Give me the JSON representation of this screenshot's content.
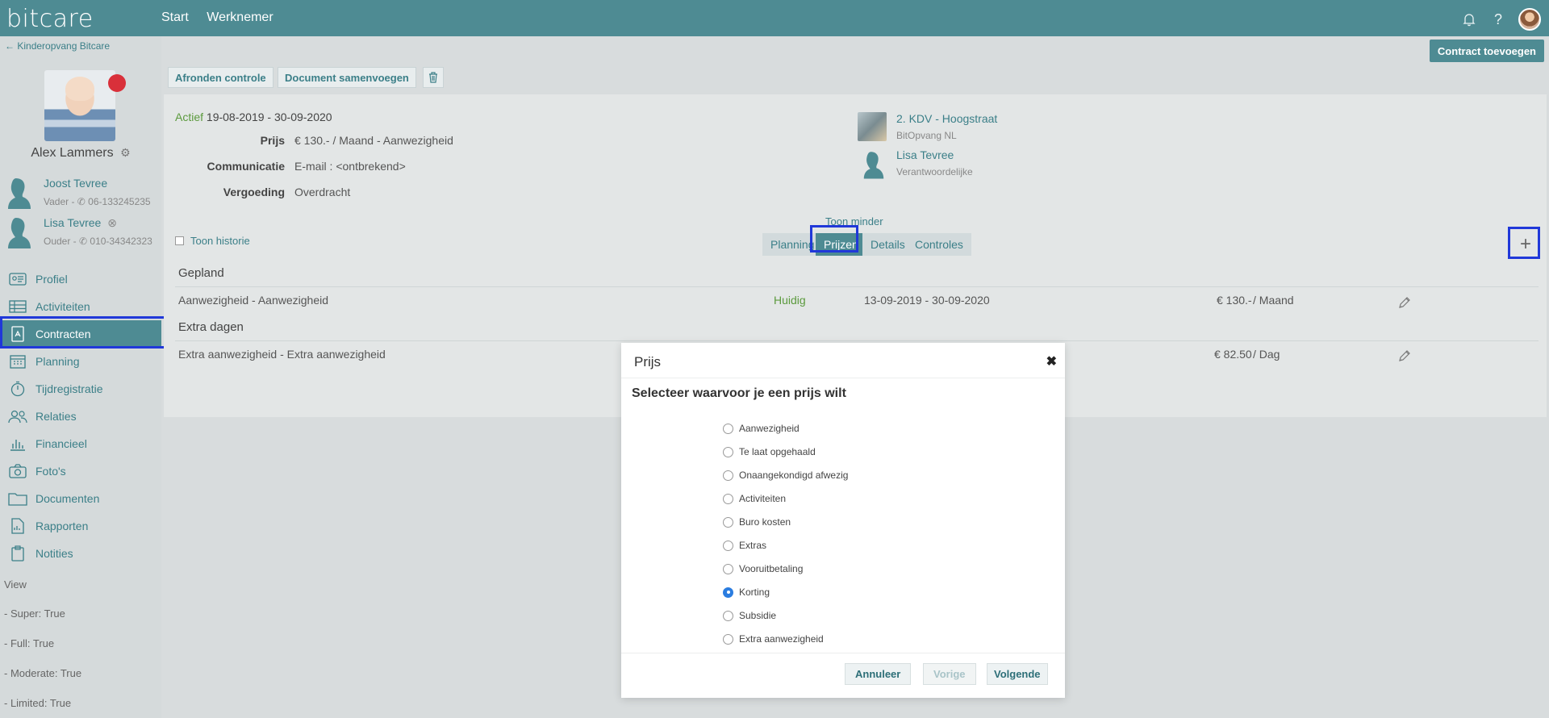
{
  "topbar": {
    "logo": "bitcare",
    "nav": [
      "Start",
      "Werknemer"
    ],
    "icons": [
      "bell-icon",
      "help-icon",
      "user-avatar"
    ]
  },
  "sidebar": {
    "back_label": "Kinderopvang Bitcare",
    "child_name": "Alex Lammers",
    "parents": [
      {
        "name": "Joost Tevree",
        "info": "Vader - ✆ 06-133245235"
      },
      {
        "name": "Lisa Tevree",
        "info": "Ouder - ✆ 010-34342323"
      }
    ],
    "nav": [
      {
        "label": "Profiel",
        "icon": "id-card-icon"
      },
      {
        "label": "Activiteiten",
        "icon": "table-icon"
      },
      {
        "label": "Contracten",
        "icon": "contract-icon",
        "active": true
      },
      {
        "label": "Planning",
        "icon": "calendar-icon"
      },
      {
        "label": "Tijdregistratie",
        "icon": "stopwatch-icon"
      },
      {
        "label": "Relaties",
        "icon": "people-icon"
      },
      {
        "label": "Financieel",
        "icon": "bar-chart-icon"
      },
      {
        "label": "Foto's",
        "icon": "camera-icon"
      },
      {
        "label": "Documenten",
        "icon": "folder-icon"
      },
      {
        "label": "Rapporten",
        "icon": "report-icon"
      },
      {
        "label": "Notities",
        "icon": "clipboard-icon"
      }
    ],
    "permissions": [
      "View",
      "- Super: True",
      "- Full: True",
      "- Moderate: True",
      "- Limited: True"
    ]
  },
  "main": {
    "contract_button": "Contract toevoegen",
    "actions": {
      "finish": "Afronden controle",
      "merge": "Document samenvoegen"
    },
    "contract": {
      "status": "Actief",
      "period": "19-08-2019 - 30-09-2020",
      "fields": [
        {
          "key": "Prijs",
          "value": "€ 130.- / Maand - Aanwezigheid"
        },
        {
          "key": "Communicatie",
          "value": "E-mail : <ontbrekend>"
        },
        {
          "key": "Vergoeding",
          "value": "Overdracht"
        }
      ],
      "location": {
        "name": "2. KDV - Hoogstraat",
        "sub": "BitOpvang NL"
      },
      "responsible": {
        "name": "Lisa Tevree",
        "sub": "Verantwoordelijke"
      }
    },
    "toon_minder": "Toon minder",
    "toon_historie": "Toon historie",
    "tabs": [
      "Planning",
      "Prijzen",
      "Details",
      "Controles"
    ],
    "sections": [
      {
        "title": "Gepland",
        "row": {
          "name": "Aanwezigheid - Aanwezigheid",
          "status": "Huidig",
          "period": "13-09-2019 - 30-09-2020",
          "price": "€ 130.-",
          "unit": "/ Maand"
        }
      },
      {
        "title": "Extra dagen",
        "row": {
          "name": "Extra aanwezigheid - Extra aanwezigheid",
          "status": "",
          "period": "",
          "price": "€ 82.50",
          "unit": "/ Dag"
        }
      }
    ]
  },
  "modal": {
    "title": "Prijs",
    "question": "Selecteer waarvoor je een prijs wilt",
    "options": [
      "Aanwezigheid",
      "Te laat opgehaald",
      "Onaangekondigd afwezig",
      "Activiteiten",
      "Buro kosten",
      "Extras",
      "Vooruitbetaling",
      "Korting",
      "Subsidie",
      "Extra aanwezigheid"
    ],
    "selected": "Korting",
    "buttons": {
      "cancel": "Annuleer",
      "prev": "Vorige",
      "next": "Volgende"
    }
  },
  "colors": {
    "brand": "#4e8b93",
    "link": "#3b7f88",
    "active_green": "#5b9a3d",
    "alert_red": "#d9303a",
    "highlight": "#2038d9"
  }
}
